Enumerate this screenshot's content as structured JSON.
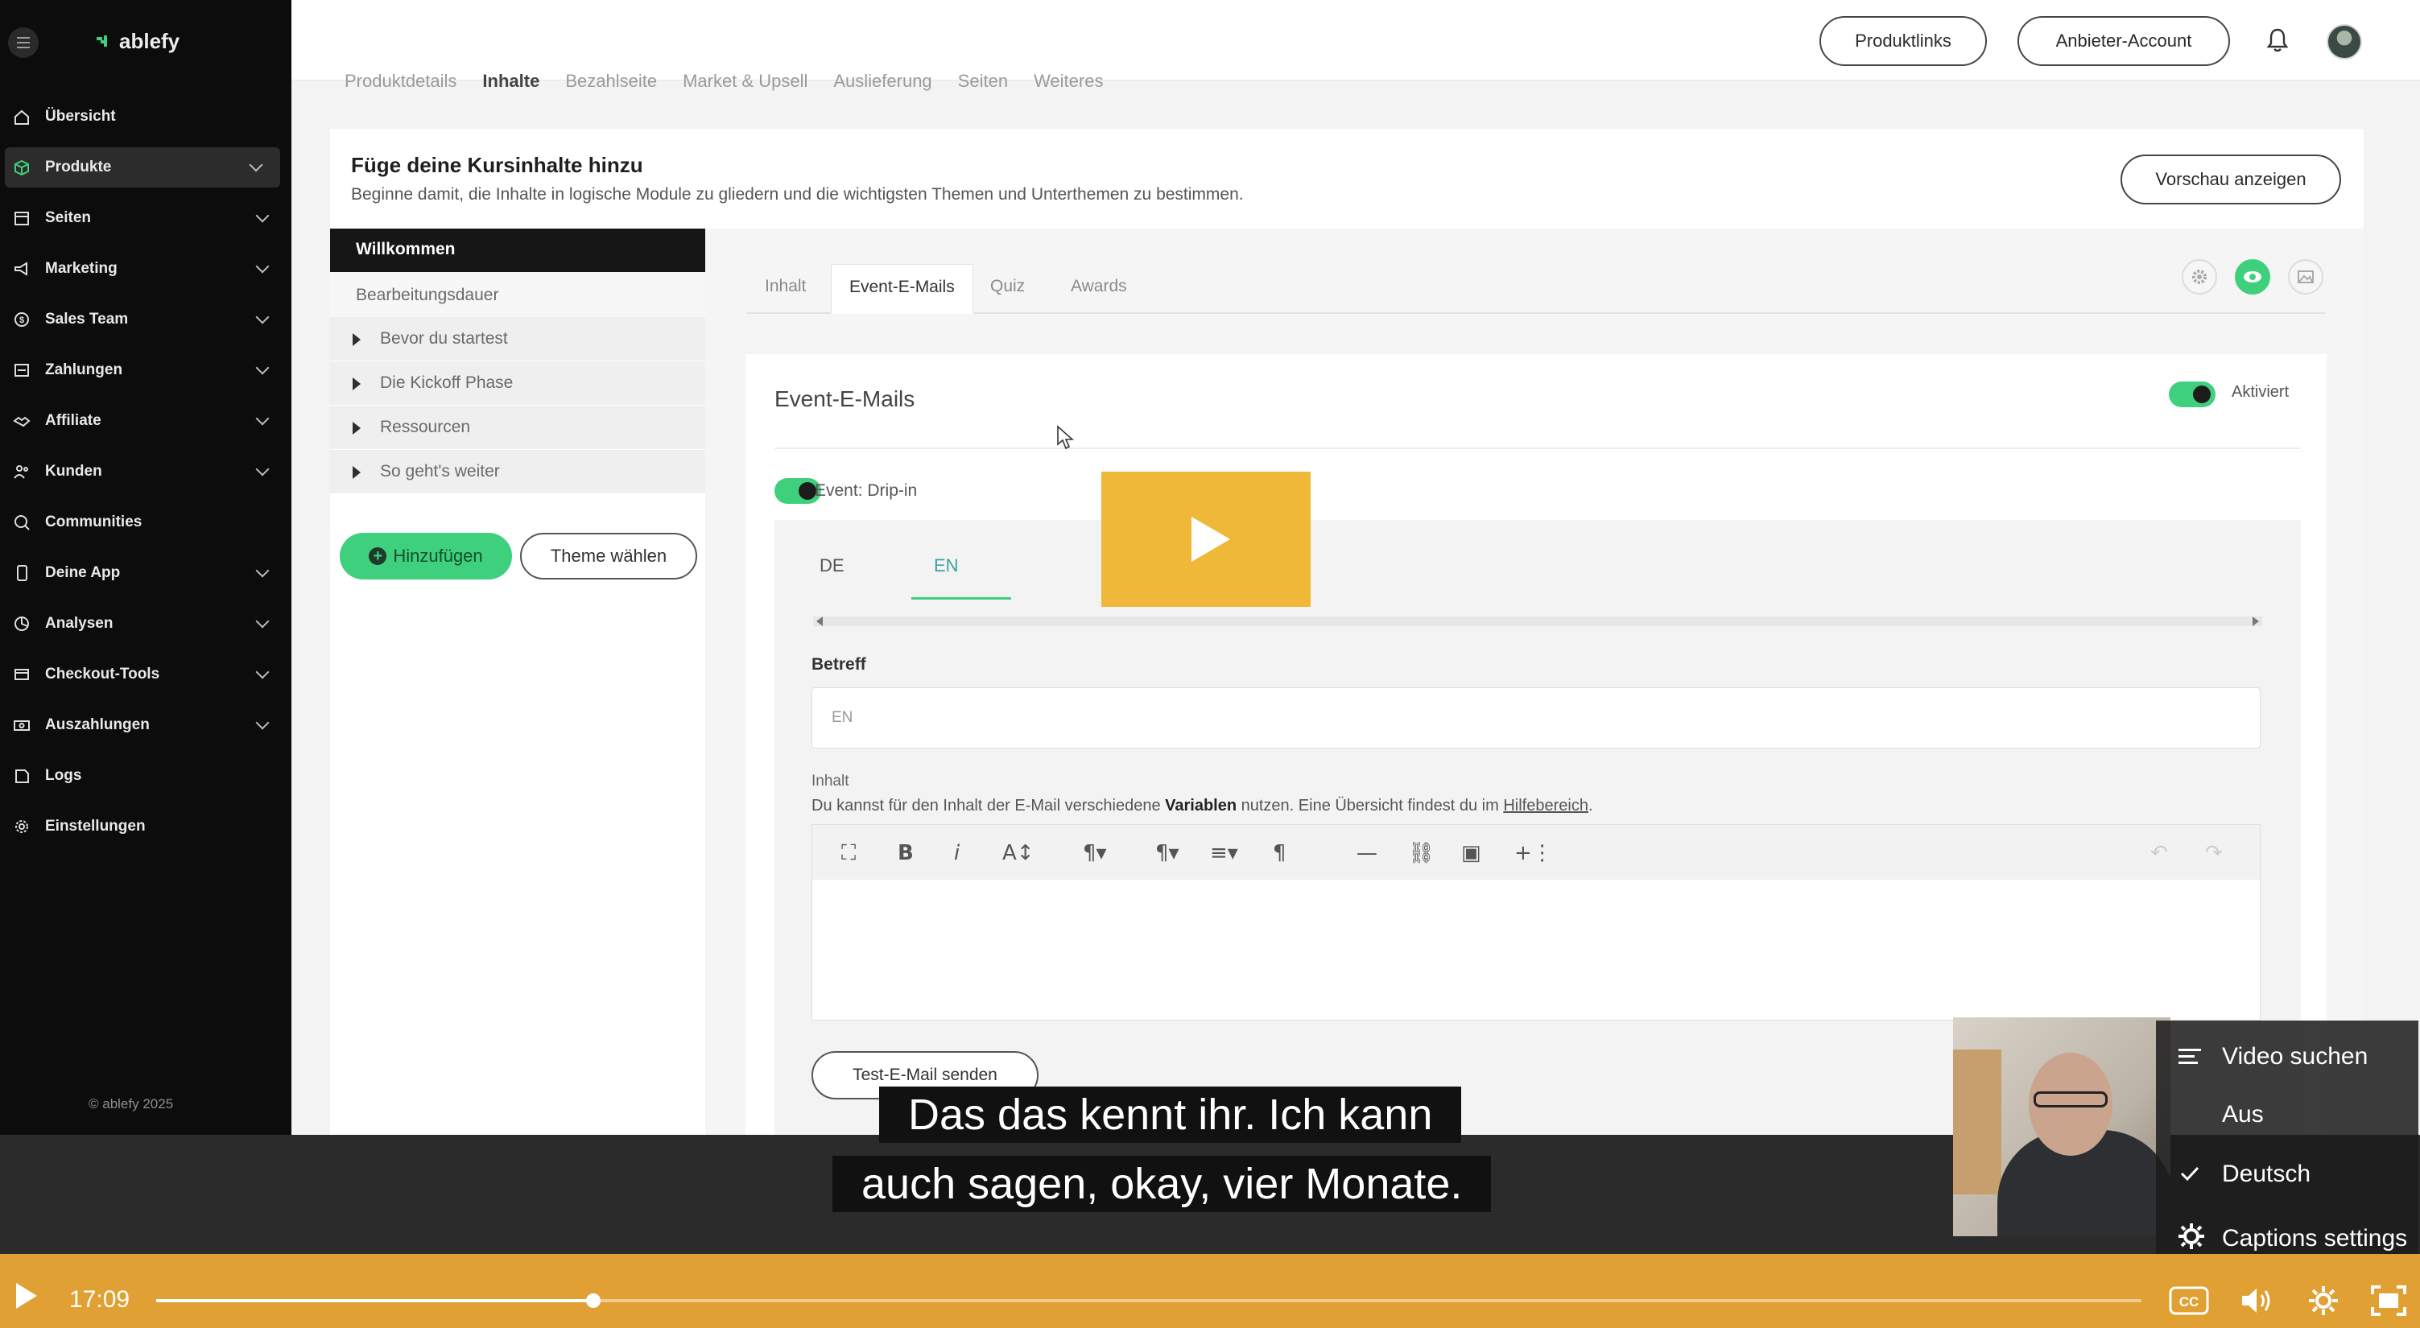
{
  "app": {
    "logo": "ablefy",
    "copyright": "© ablefy 2025",
    "nav": [
      {
        "label": "Übersicht",
        "icon": "home-icon",
        "has_chevron": false
      },
      {
        "label": "Produkte",
        "icon": "box-icon",
        "has_chevron": true,
        "active": true
      },
      {
        "label": "Seiten",
        "icon": "page-icon",
        "has_chevron": true
      },
      {
        "label": "Marketing",
        "icon": "megaphone-icon",
        "has_chevron": true
      },
      {
        "label": "Sales Team",
        "icon": "dollar-circle-icon",
        "has_chevron": true
      },
      {
        "label": "Zahlungen",
        "icon": "payment-icon",
        "has_chevron": true
      },
      {
        "label": "Affiliate",
        "icon": "handshake-icon",
        "has_chevron": true
      },
      {
        "label": "Kunden",
        "icon": "users-icon",
        "has_chevron": true
      },
      {
        "label": "Communities",
        "icon": "chat-icon",
        "has_chevron": false
      },
      {
        "label": "Deine App",
        "icon": "phone-icon",
        "has_chevron": true
      },
      {
        "label": "Analysen",
        "icon": "pie-icon",
        "has_chevron": true
      },
      {
        "label": "Checkout-Tools",
        "icon": "cart-icon",
        "has_chevron": true
      },
      {
        "label": "Auszahlungen",
        "icon": "cash-icon",
        "has_chevron": true
      },
      {
        "label": "Logs",
        "icon": "log-icon",
        "has_chevron": false
      },
      {
        "label": "Einstellungen",
        "icon": "gear-icon",
        "has_chevron": false
      }
    ],
    "header": {
      "produktlinks": "Produktlinks",
      "anbieter_account": "Anbieter-Account"
    },
    "subnav": [
      "Produktdetails",
      "Inhalte",
      "Bezahlseite",
      "Market & Upsell",
      "Auslieferung",
      "Seiten",
      "Weiteres"
    ],
    "subnav_current": "Inhalte",
    "course": {
      "title": "Füge deine Kursinhalte hinzu",
      "subtitle": "Beginne damit, die Inhalte in logische Module zu gliedern und die wichtigsten Themen und Unterthemen zu bestimmen.",
      "preview_button": "Vorschau anzeigen"
    },
    "modules": {
      "welcome": "Willkommen",
      "duration": "Bearbeitungsdauer",
      "items": [
        "Bevor du startest",
        "Die Kickoff Phase",
        "Ressourcen",
        "So geht's weiter"
      ],
      "add_button": "Hinzufügen",
      "theme_button": "Theme wählen"
    },
    "tabs": [
      "Inhalt",
      "Event-E-Mails",
      "Quiz",
      "Awards"
    ],
    "tab_current": "Event-E-Mails",
    "event_panel": {
      "title": "Event-E-Mails",
      "activated_label": "Aktiviert",
      "event_label": "Event: Drip-in",
      "languages": [
        "DE",
        "EN"
      ],
      "language_current": "EN",
      "subject_label": "Betreff",
      "subject_value": "EN",
      "content_label": "Inhalt",
      "hint_prefix": "Du kannst für den Inhalt der E-Mail verschiedene ",
      "hint_bold": "Variablen",
      "hint_mid": " nutzen. Eine Übersicht findest du im ",
      "hint_link": "Hilfebereich",
      "hint_suffix": ".",
      "test_button": "Test-E-Mail senden"
    }
  },
  "video": {
    "subtitle_line1": "Das das kennt ihr. Ich kann",
    "subtitle_line2": "auch sagen, okay, vier Monate.",
    "time": "17:09",
    "progress_fraction": 0.22,
    "accent": "#e0a033",
    "captions_menu": {
      "search": "Video suchen",
      "off": "Aus",
      "german": "Deutsch",
      "settings": "Captions settings"
    }
  }
}
